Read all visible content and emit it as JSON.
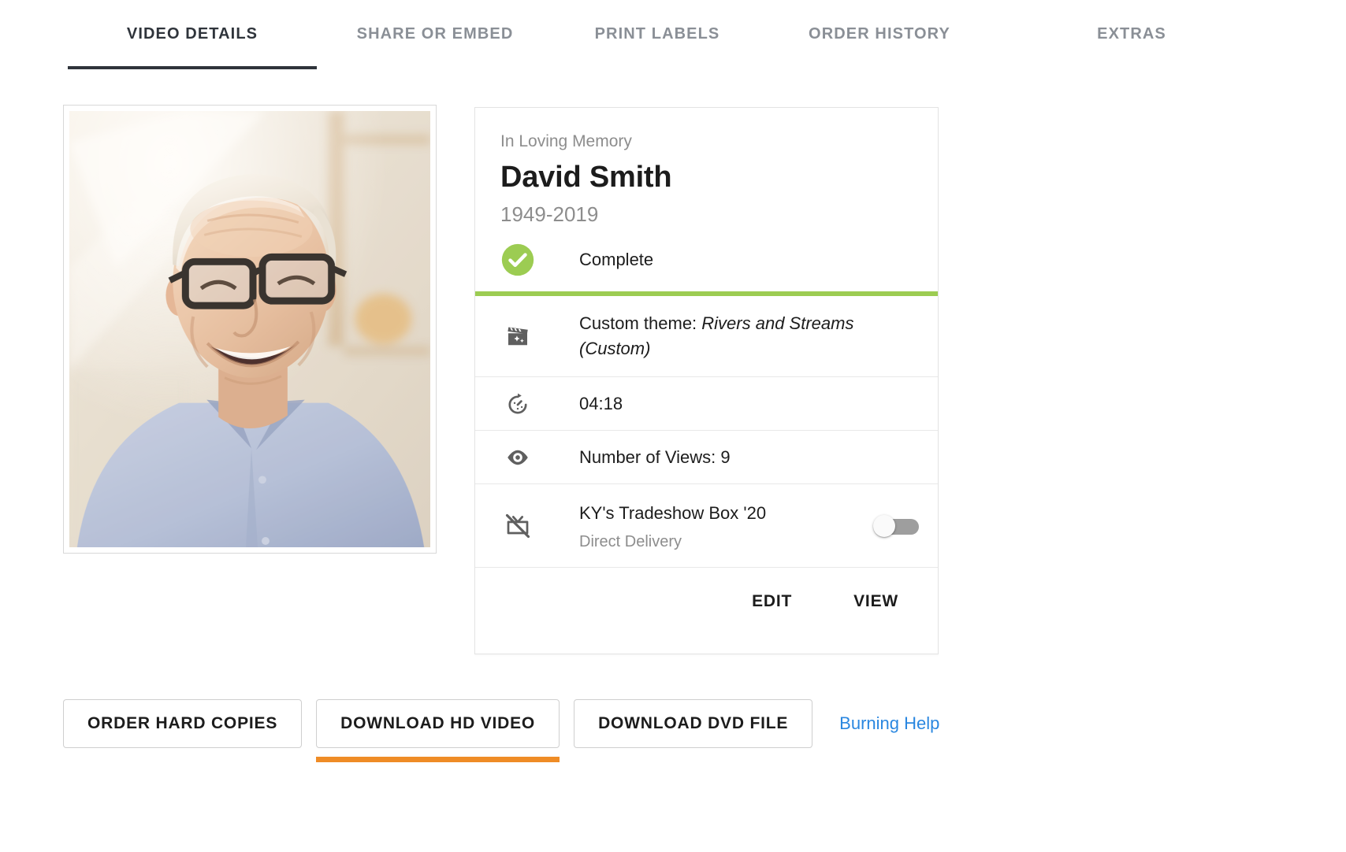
{
  "tabs": [
    {
      "label": "VIDEO DETAILS",
      "active": true
    },
    {
      "label": "SHARE OR EMBED",
      "active": false
    },
    {
      "label": "PRINT LABELS",
      "active": false
    },
    {
      "label": "ORDER HISTORY",
      "active": false
    },
    {
      "label": "EXTRAS",
      "active": false
    }
  ],
  "photo": {
    "alt": "Portrait of smiling elderly man with white hair, dark glasses and light blue shirt"
  },
  "card": {
    "memory_label": "In Loving Memory",
    "name": "David Smith",
    "years": "1949-2019",
    "status": "Complete",
    "status_icon": "check-circle-icon",
    "progress_color": "#9ccc52",
    "rows": [
      {
        "icon": "movie-filter-icon",
        "label_prefix": "Custom theme: ",
        "value_italic": "Rivers and Streams (Custom)"
      },
      {
        "icon": "timer-icon",
        "text": "04:18"
      },
      {
        "icon": "eye-icon",
        "text": "Number of Views: 9"
      }
    ],
    "delivery": {
      "icon": "tv-off-icon",
      "title": "KY's Tradeshow Box '20",
      "subtitle": "Direct Delivery",
      "toggle_on": false
    },
    "actions": {
      "edit": "EDIT",
      "view": "VIEW"
    }
  },
  "bottom": {
    "buttons": [
      {
        "label": "ORDER HARD COPIES",
        "active": false
      },
      {
        "label": "DOWNLOAD HD VIDEO",
        "active": true
      },
      {
        "label": "DOWNLOAD DVD FILE",
        "active": false
      }
    ],
    "help_link": "Burning Help",
    "accent_color": "#ef8c26",
    "link_color": "#2a87e0"
  }
}
